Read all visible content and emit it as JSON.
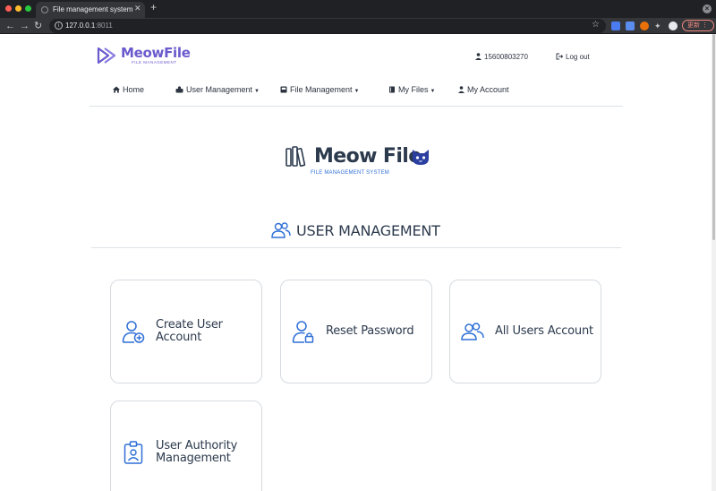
{
  "browser": {
    "tab_title": "File management system",
    "tab_close": "✕",
    "new_tab": "+",
    "url_host": "127.0.0.1",
    "url_port": ":8011",
    "update_label": "更新",
    "update_menu": "⋮"
  },
  "header": {
    "logo_text": "MeowFile",
    "logo_sub": "FILE MANAGEMENT",
    "user_id": "15600803270",
    "logout": "Log out"
  },
  "nav": {
    "home": "Home",
    "user_management": "User Management",
    "file_management": "File Management",
    "my_files": "My Files",
    "my_account": "My Account"
  },
  "brand": {
    "title": "Meow File",
    "subtitle": "FILE MANAGEMENT SYSTEM"
  },
  "section": {
    "title": "USER MANAGEMENT"
  },
  "cards": {
    "create_user_line1": "Create User",
    "create_user_line2": "Account",
    "reset_password": "Reset Password",
    "all_users": "All Users Account",
    "authority_line1": "User Authority",
    "authority_line2": "Management"
  },
  "colors": {
    "accent_blue": "#2f6fd6",
    "logo_purple": "#6a5acd",
    "text_dark": "#2c3a4d"
  }
}
